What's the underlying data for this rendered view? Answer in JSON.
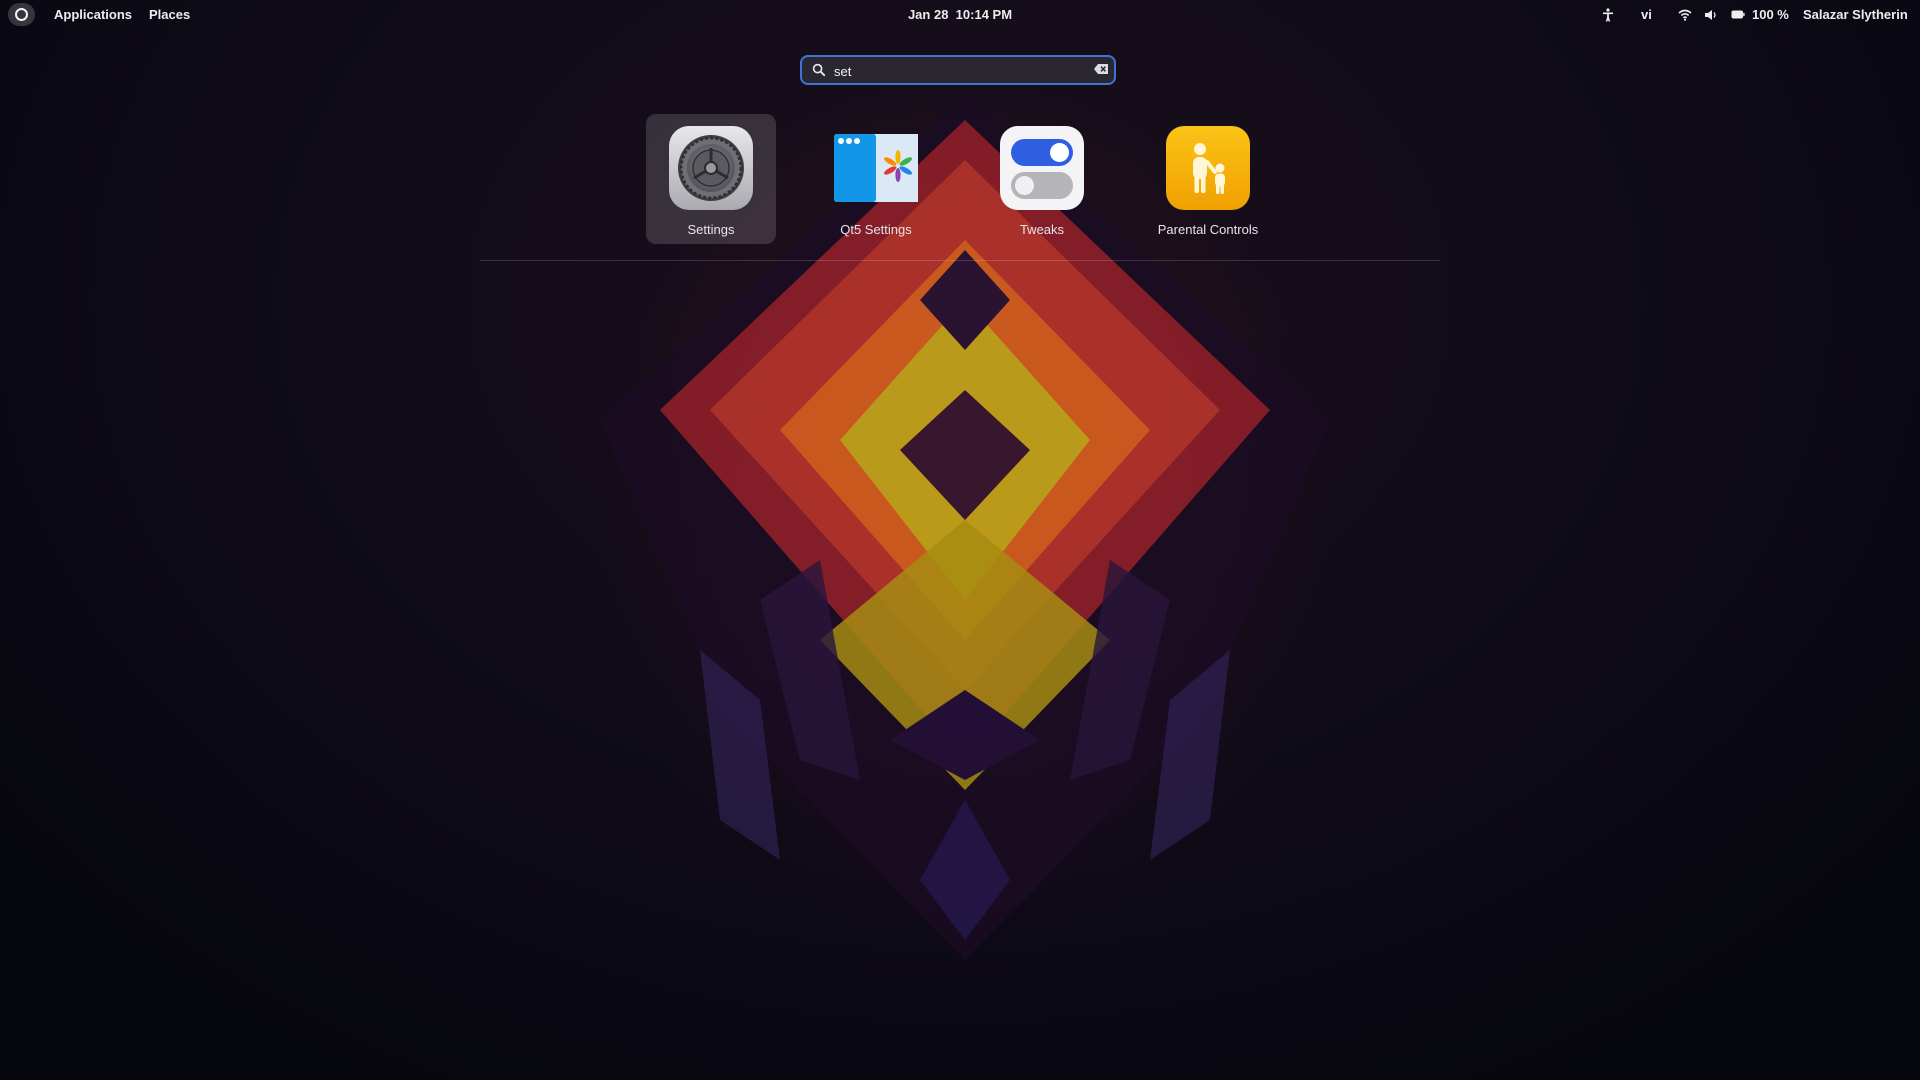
{
  "top_bar": {
    "applications_label": "Applications",
    "places_label": "Places",
    "date": "Jan 28",
    "time": "10:14 PM",
    "keyboard_layout": "vi",
    "battery_percent": "100 %",
    "user_name": "Salazar Slytherin"
  },
  "search": {
    "query": "set",
    "placeholder": ""
  },
  "results": [
    {
      "label": "Settings",
      "icon": "settings-gear-icon",
      "selected": true
    },
    {
      "label": "Qt5 Settings",
      "icon": "qt5-settings-icon",
      "selected": false
    },
    {
      "label": "Tweaks",
      "icon": "tweaks-toggle-icon",
      "selected": false
    },
    {
      "label": "Parental Controls",
      "icon": "parental-controls-icon",
      "selected": false
    }
  ],
  "colors": {
    "search_focus": "#3d75d6",
    "tweaks_toggle": "#2f5fe0",
    "parental_controls": "#f5b400"
  }
}
